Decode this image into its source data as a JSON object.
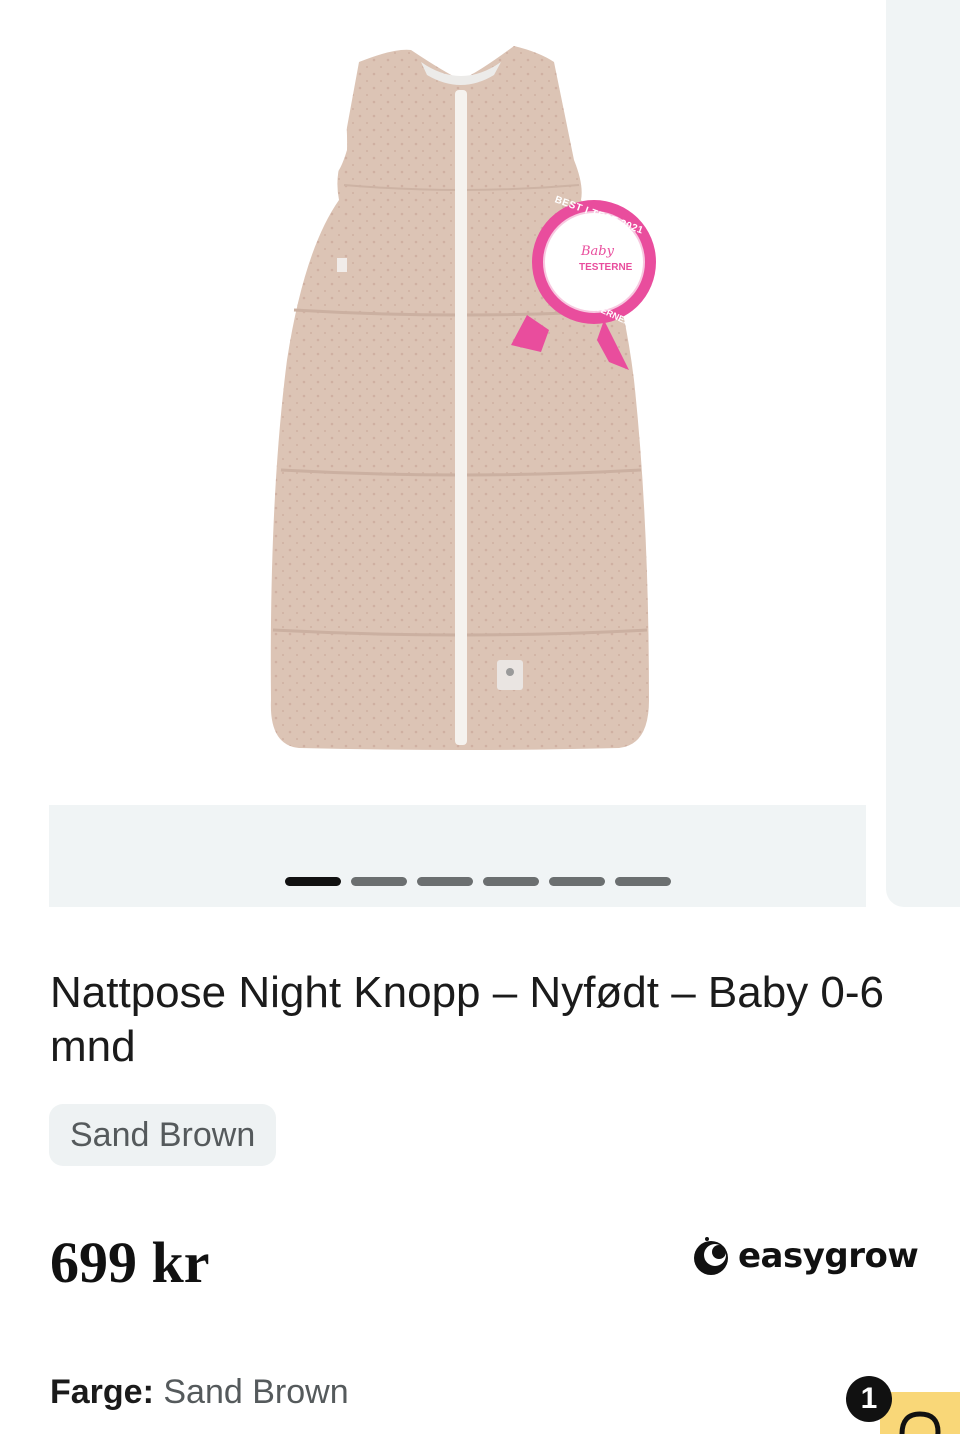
{
  "gallery": {
    "slide_count": 6,
    "active_index": 0,
    "award_badge": {
      "arc_text_top": "BEST I TEST 2021",
      "center_text_1": "Baby",
      "center_text_2": "TESTERNE",
      "arc_text_bottom": "BABYTESTERNE.NO"
    }
  },
  "product": {
    "title": "Nattpose Night Knopp – Nyfødt – Baby 0-6 mnd",
    "color_chip": "Sand Brown",
    "price": "699 kr",
    "brand_name": "easygrow",
    "color_label": "Farge:",
    "color_value": "Sand Brown"
  },
  "floating": {
    "badge_count": "1"
  },
  "colors": {
    "sleeping_bag": "#dcc4b5",
    "zipper": "#f5f2ee",
    "award_pink": "#e94d9d",
    "chat_yellow": "#f9d778",
    "gallery_bg": "#f0f4f5"
  },
  "icons": {
    "brand": "easygrow-logo-icon",
    "chat": "chat-icon"
  }
}
